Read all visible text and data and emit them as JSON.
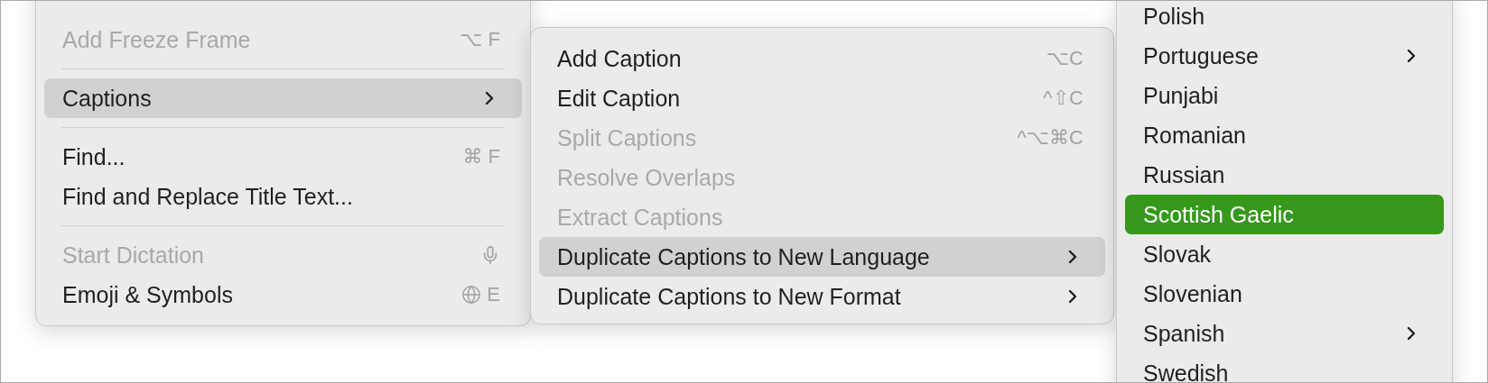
{
  "menus": [
    {
      "active": false,
      "items": [
        {
          "kind": "item",
          "label": "Add Freeze Frame",
          "shortcut": "⌥ F",
          "disabled": true,
          "selected": false,
          "submenu": false
        },
        {
          "kind": "separator"
        },
        {
          "kind": "item",
          "label": "Captions",
          "disabled": false,
          "selected": true,
          "submenu": true
        },
        {
          "kind": "separator"
        },
        {
          "kind": "item",
          "label": "Find...",
          "shortcut": "⌘ F",
          "disabled": false,
          "selected": false,
          "submenu": false
        },
        {
          "kind": "item",
          "label": "Find and Replace Title Text...",
          "disabled": false,
          "selected": false,
          "submenu": false
        },
        {
          "kind": "separator"
        },
        {
          "kind": "item",
          "label": "Start Dictation",
          "mic_icon": true,
          "disabled": true,
          "selected": false,
          "submenu": false
        },
        {
          "kind": "item",
          "label": "Emoji & Symbols",
          "globe_icon": true,
          "shortcut": "E",
          "disabled": false,
          "selected": false,
          "submenu": false
        }
      ]
    },
    {
      "active": false,
      "items": [
        {
          "kind": "item",
          "label": "Add Caption",
          "shortcut": "⌥C",
          "disabled": false,
          "selected": false,
          "submenu": false
        },
        {
          "kind": "item",
          "label": "Edit Caption",
          "shortcut": "^⇧C",
          "disabled": false,
          "selected": false,
          "submenu": false
        },
        {
          "kind": "item",
          "label": "Split Captions",
          "shortcut": "^⌥⌘C",
          "disabled": true,
          "selected": false,
          "submenu": false
        },
        {
          "kind": "item",
          "label": "Resolve Overlaps",
          "disabled": true,
          "selected": false,
          "submenu": false
        },
        {
          "kind": "item",
          "label": "Extract Captions",
          "disabled": true,
          "selected": false,
          "submenu": false
        },
        {
          "kind": "item",
          "label": "Duplicate Captions to New Language",
          "disabled": false,
          "selected": true,
          "submenu": true
        },
        {
          "kind": "item",
          "label": "Duplicate Captions to New Format",
          "disabled": false,
          "selected": false,
          "submenu": true
        }
      ]
    },
    {
      "active": true,
      "items": [
        {
          "kind": "item",
          "label": "Polish",
          "disabled": false,
          "selected": false,
          "submenu": false
        },
        {
          "kind": "item",
          "label": "Portuguese",
          "disabled": false,
          "selected": false,
          "submenu": true
        },
        {
          "kind": "item",
          "label": "Punjabi",
          "disabled": false,
          "selected": false,
          "submenu": false
        },
        {
          "kind": "item",
          "label": "Romanian",
          "disabled": false,
          "selected": false,
          "submenu": false
        },
        {
          "kind": "item",
          "label": "Russian",
          "disabled": false,
          "selected": false,
          "submenu": false
        },
        {
          "kind": "item",
          "label": "Scottish Gaelic",
          "disabled": false,
          "selected": true,
          "submenu": false
        },
        {
          "kind": "item",
          "label": "Slovak",
          "disabled": false,
          "selected": false,
          "submenu": false
        },
        {
          "kind": "item",
          "label": "Slovenian",
          "disabled": false,
          "selected": false,
          "submenu": false
        },
        {
          "kind": "item",
          "label": "Spanish",
          "disabled": false,
          "selected": false,
          "submenu": true
        },
        {
          "kind": "item",
          "label": "Swedish",
          "disabled": false,
          "selected": false,
          "submenu": false
        }
      ]
    }
  ]
}
